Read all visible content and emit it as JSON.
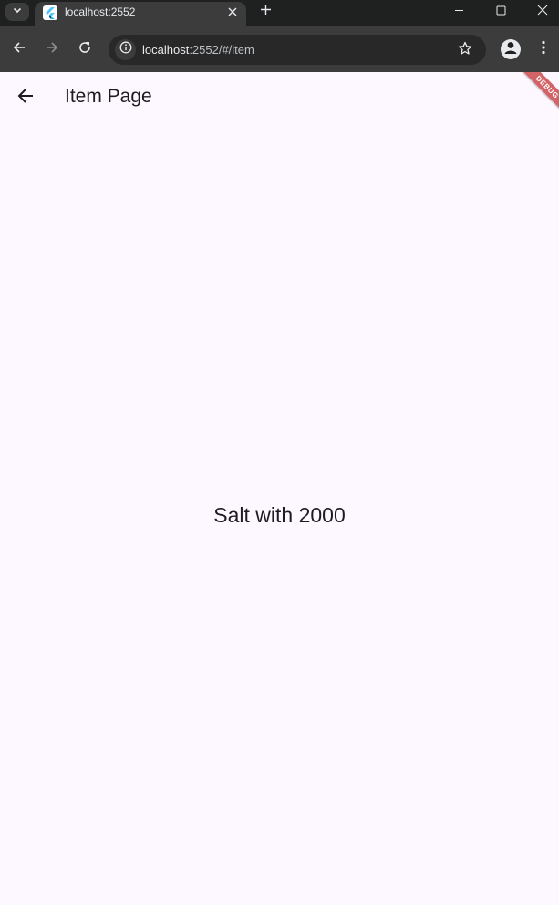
{
  "browser": {
    "tab_title": "localhost:2552",
    "url_host": "localhost",
    "url_path": ":2552/#/item"
  },
  "app": {
    "appbar_title": "Item Page",
    "body_text": "Salt with 2000",
    "debug_label": "DEBUG"
  },
  "colors": {
    "page_background": "#fdf7ff",
    "text": "#1d1b20",
    "chrome_dark": "#1f2020",
    "chrome_toolbar": "#3c3c3c",
    "debug_banner": "#b80000"
  }
}
